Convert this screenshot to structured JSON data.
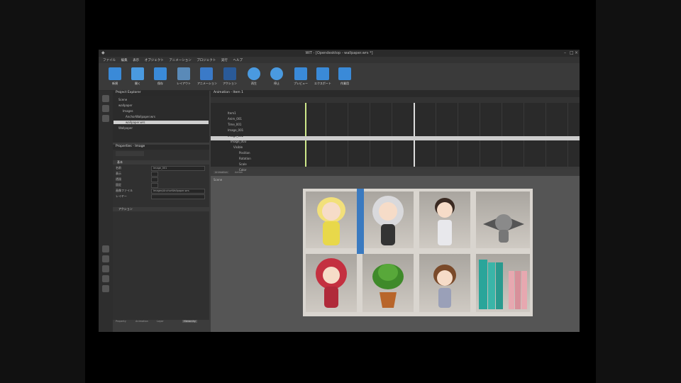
{
  "window": {
    "title": "WIT - [Opendesktop - wallpaper.wrs *]"
  },
  "menu": [
    "ファイル",
    "編集",
    "表示",
    "オブジェクト",
    "アニメーション",
    "プロジェクト",
    "実行",
    "ヘルプ"
  ],
  "toolbar": [
    {
      "label": "新規",
      "icon": "new-icon",
      "color": "#3a8ad8"
    },
    {
      "label": "開く",
      "icon": "open-icon",
      "color": "#4a9ae0"
    },
    {
      "label": "保存",
      "icon": "save-icon",
      "color": "#3a8ad8"
    },
    {
      "label": "レイアウト",
      "icon": "layout-icon",
      "color": "#5a8ab8"
    },
    {
      "label": "アニメーション",
      "icon": "animation-icon",
      "color": "#3a7ac8"
    },
    {
      "label": "アクション",
      "icon": "action-icon",
      "color": "#2a5a98"
    },
    {
      "label": "再生",
      "icon": "play-icon",
      "color": "#4a9ae0"
    },
    {
      "label": "停止",
      "icon": "stop-icon",
      "color": "#4a9ae0"
    },
    {
      "label": "プレビュー",
      "icon": "preview-icon",
      "color": "#3a8ad8"
    },
    {
      "label": "エクスポート",
      "icon": "export-icon",
      "color": "#3a8ad8"
    },
    {
      "label": "作業用",
      "icon": "work-icon",
      "color": "#3a8ad8"
    }
  ],
  "project": {
    "header": "Project Explorer",
    "items": [
      "Scene",
      "wallpaper",
      "Images",
      "AnchorWallpaper.wrs",
      "wallpaper.wrs",
      "Wallpaper"
    ]
  },
  "properties": {
    "header": "Properties - Image",
    "section": "基本",
    "rows": [
      {
        "label": "名前",
        "value": "Image_001"
      },
      {
        "label": "表示",
        "value": ""
      },
      {
        "label": "透過",
        "value": ""
      },
      {
        "label": "固定",
        "value": ""
      },
      {
        "label": "画像ファイル",
        "value": "Images/AnchorWallpaper.wrs"
      },
      {
        "label": "レイヤー",
        "value": ""
      }
    ],
    "section2": "アクション",
    "tabs": [
      "Property",
      "Animation",
      "Layer",
      "Hierarchy"
    ]
  },
  "animation": {
    "header": "Animation - Item 1",
    "tracks": [
      "Item1",
      "Anim_001",
      "Time_001",
      "Image_001",
      "Image_002",
      "Image_003",
      "Visible",
      "Position",
      "Rotation",
      "Scale",
      "Color"
    ],
    "selected_index": 3,
    "tabs": [
      "Animation",
      "Action"
    ]
  },
  "scene": {
    "label": "Scene"
  }
}
